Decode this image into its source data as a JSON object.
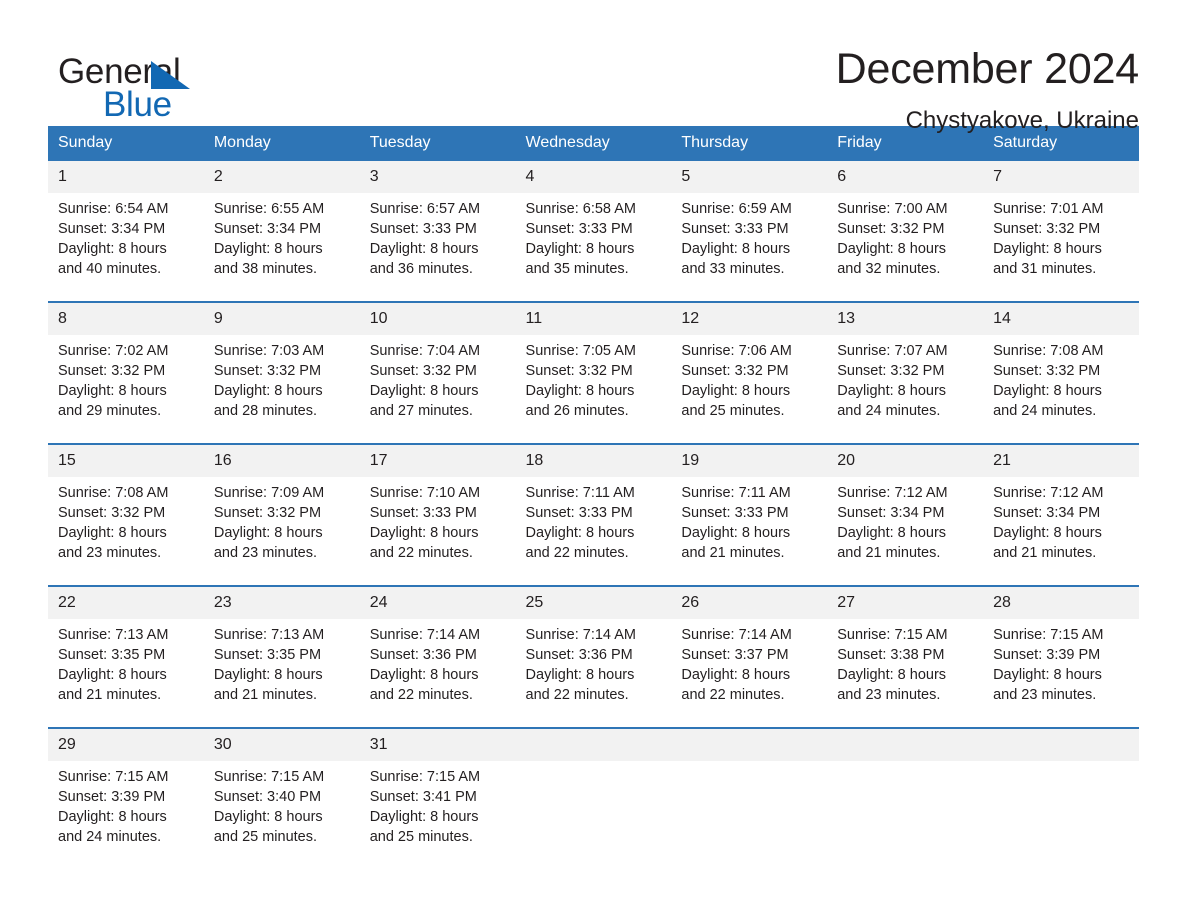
{
  "brand": {
    "name_part1": "General",
    "name_part2": "Blue",
    "triangle_color": "#1268b3"
  },
  "header": {
    "title": "December 2024",
    "location": "Chystyakove, Ukraine"
  },
  "theme": {
    "header_blue": "#2e75b6",
    "daynum_band": "#f2f2f2",
    "text": "#231f20"
  },
  "weekday_headers": [
    "Sunday",
    "Monday",
    "Tuesday",
    "Wednesday",
    "Thursday",
    "Friday",
    "Saturday"
  ],
  "weeks": [
    [
      {
        "day": "1",
        "sunrise": "Sunrise: 6:54 AM",
        "sunset": "Sunset: 3:34 PM",
        "daylight_line1": "Daylight: 8 hours",
        "daylight_line2": "and 40 minutes."
      },
      {
        "day": "2",
        "sunrise": "Sunrise: 6:55 AM",
        "sunset": "Sunset: 3:34 PM",
        "daylight_line1": "Daylight: 8 hours",
        "daylight_line2": "and 38 minutes."
      },
      {
        "day": "3",
        "sunrise": "Sunrise: 6:57 AM",
        "sunset": "Sunset: 3:33 PM",
        "daylight_line1": "Daylight: 8 hours",
        "daylight_line2": "and 36 minutes."
      },
      {
        "day": "4",
        "sunrise": "Sunrise: 6:58 AM",
        "sunset": "Sunset: 3:33 PM",
        "daylight_line1": "Daylight: 8 hours",
        "daylight_line2": "and 35 minutes."
      },
      {
        "day": "5",
        "sunrise": "Sunrise: 6:59 AM",
        "sunset": "Sunset: 3:33 PM",
        "daylight_line1": "Daylight: 8 hours",
        "daylight_line2": "and 33 minutes."
      },
      {
        "day": "6",
        "sunrise": "Sunrise: 7:00 AM",
        "sunset": "Sunset: 3:32 PM",
        "daylight_line1": "Daylight: 8 hours",
        "daylight_line2": "and 32 minutes."
      },
      {
        "day": "7",
        "sunrise": "Sunrise: 7:01 AM",
        "sunset": "Sunset: 3:32 PM",
        "daylight_line1": "Daylight: 8 hours",
        "daylight_line2": "and 31 minutes."
      }
    ],
    [
      {
        "day": "8",
        "sunrise": "Sunrise: 7:02 AM",
        "sunset": "Sunset: 3:32 PM",
        "daylight_line1": "Daylight: 8 hours",
        "daylight_line2": "and 29 minutes."
      },
      {
        "day": "9",
        "sunrise": "Sunrise: 7:03 AM",
        "sunset": "Sunset: 3:32 PM",
        "daylight_line1": "Daylight: 8 hours",
        "daylight_line2": "and 28 minutes."
      },
      {
        "day": "10",
        "sunrise": "Sunrise: 7:04 AM",
        "sunset": "Sunset: 3:32 PM",
        "daylight_line1": "Daylight: 8 hours",
        "daylight_line2": "and 27 minutes."
      },
      {
        "day": "11",
        "sunrise": "Sunrise: 7:05 AM",
        "sunset": "Sunset: 3:32 PM",
        "daylight_line1": "Daylight: 8 hours",
        "daylight_line2": "and 26 minutes."
      },
      {
        "day": "12",
        "sunrise": "Sunrise: 7:06 AM",
        "sunset": "Sunset: 3:32 PM",
        "daylight_line1": "Daylight: 8 hours",
        "daylight_line2": "and 25 minutes."
      },
      {
        "day": "13",
        "sunrise": "Sunrise: 7:07 AM",
        "sunset": "Sunset: 3:32 PM",
        "daylight_line1": "Daylight: 8 hours",
        "daylight_line2": "and 24 minutes."
      },
      {
        "day": "14",
        "sunrise": "Sunrise: 7:08 AM",
        "sunset": "Sunset: 3:32 PM",
        "daylight_line1": "Daylight: 8 hours",
        "daylight_line2": "and 24 minutes."
      }
    ],
    [
      {
        "day": "15",
        "sunrise": "Sunrise: 7:08 AM",
        "sunset": "Sunset: 3:32 PM",
        "daylight_line1": "Daylight: 8 hours",
        "daylight_line2": "and 23 minutes."
      },
      {
        "day": "16",
        "sunrise": "Sunrise: 7:09 AM",
        "sunset": "Sunset: 3:32 PM",
        "daylight_line1": "Daylight: 8 hours",
        "daylight_line2": "and 23 minutes."
      },
      {
        "day": "17",
        "sunrise": "Sunrise: 7:10 AM",
        "sunset": "Sunset: 3:33 PM",
        "daylight_line1": "Daylight: 8 hours",
        "daylight_line2": "and 22 minutes."
      },
      {
        "day": "18",
        "sunrise": "Sunrise: 7:11 AM",
        "sunset": "Sunset: 3:33 PM",
        "daylight_line1": "Daylight: 8 hours",
        "daylight_line2": "and 22 minutes."
      },
      {
        "day": "19",
        "sunrise": "Sunrise: 7:11 AM",
        "sunset": "Sunset: 3:33 PM",
        "daylight_line1": "Daylight: 8 hours",
        "daylight_line2": "and 21 minutes."
      },
      {
        "day": "20",
        "sunrise": "Sunrise: 7:12 AM",
        "sunset": "Sunset: 3:34 PM",
        "daylight_line1": "Daylight: 8 hours",
        "daylight_line2": "and 21 minutes."
      },
      {
        "day": "21",
        "sunrise": "Sunrise: 7:12 AM",
        "sunset": "Sunset: 3:34 PM",
        "daylight_line1": "Daylight: 8 hours",
        "daylight_line2": "and 21 minutes."
      }
    ],
    [
      {
        "day": "22",
        "sunrise": "Sunrise: 7:13 AM",
        "sunset": "Sunset: 3:35 PM",
        "daylight_line1": "Daylight: 8 hours",
        "daylight_line2": "and 21 minutes."
      },
      {
        "day": "23",
        "sunrise": "Sunrise: 7:13 AM",
        "sunset": "Sunset: 3:35 PM",
        "daylight_line1": "Daylight: 8 hours",
        "daylight_line2": "and 21 minutes."
      },
      {
        "day": "24",
        "sunrise": "Sunrise: 7:14 AM",
        "sunset": "Sunset: 3:36 PM",
        "daylight_line1": "Daylight: 8 hours",
        "daylight_line2": "and 22 minutes."
      },
      {
        "day": "25",
        "sunrise": "Sunrise: 7:14 AM",
        "sunset": "Sunset: 3:36 PM",
        "daylight_line1": "Daylight: 8 hours",
        "daylight_line2": "and 22 minutes."
      },
      {
        "day": "26",
        "sunrise": "Sunrise: 7:14 AM",
        "sunset": "Sunset: 3:37 PM",
        "daylight_line1": "Daylight: 8 hours",
        "daylight_line2": "and 22 minutes."
      },
      {
        "day": "27",
        "sunrise": "Sunrise: 7:15 AM",
        "sunset": "Sunset: 3:38 PM",
        "daylight_line1": "Daylight: 8 hours",
        "daylight_line2": "and 23 minutes."
      },
      {
        "day": "28",
        "sunrise": "Sunrise: 7:15 AM",
        "sunset": "Sunset: 3:39 PM",
        "daylight_line1": "Daylight: 8 hours",
        "daylight_line2": "and 23 minutes."
      }
    ],
    [
      {
        "day": "29",
        "sunrise": "Sunrise: 7:15 AM",
        "sunset": "Sunset: 3:39 PM",
        "daylight_line1": "Daylight: 8 hours",
        "daylight_line2": "and 24 minutes."
      },
      {
        "day": "30",
        "sunrise": "Sunrise: 7:15 AM",
        "sunset": "Sunset: 3:40 PM",
        "daylight_line1": "Daylight: 8 hours",
        "daylight_line2": "and 25 minutes."
      },
      {
        "day": "31",
        "sunrise": "Sunrise: 7:15 AM",
        "sunset": "Sunset: 3:41 PM",
        "daylight_line1": "Daylight: 8 hours",
        "daylight_line2": "and 25 minutes."
      },
      {
        "day": "",
        "sunrise": "",
        "sunset": "",
        "daylight_line1": "",
        "daylight_line2": ""
      },
      {
        "day": "",
        "sunrise": "",
        "sunset": "",
        "daylight_line1": "",
        "daylight_line2": ""
      },
      {
        "day": "",
        "sunrise": "",
        "sunset": "",
        "daylight_line1": "",
        "daylight_line2": ""
      },
      {
        "day": "",
        "sunrise": "",
        "sunset": "",
        "daylight_line1": "",
        "daylight_line2": ""
      }
    ]
  ]
}
